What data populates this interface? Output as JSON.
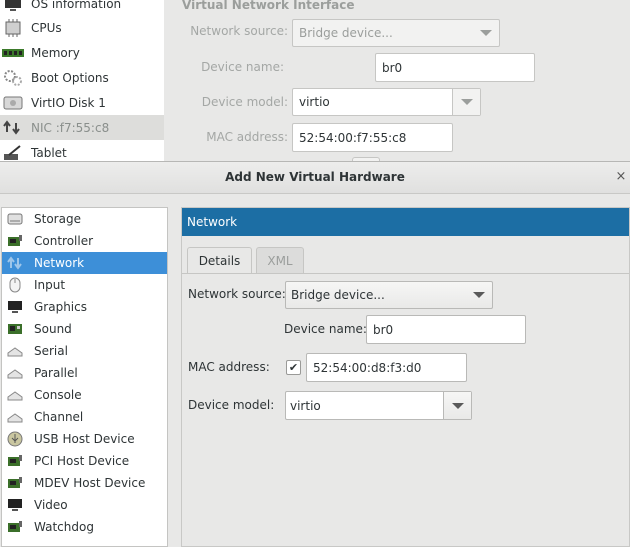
{
  "background_window": {
    "sidebar": [
      {
        "label": "OS information",
        "icon": "monitor-icon"
      },
      {
        "label": "CPUs",
        "icon": "cpu-icon"
      },
      {
        "label": "Memory",
        "icon": "memory-icon"
      },
      {
        "label": "Boot Options",
        "icon": "gears-icon"
      },
      {
        "label": "VirtIO Disk 1",
        "icon": "disk-icon"
      },
      {
        "label": "NIC :f7:55:c8",
        "icon": "nic-icon"
      },
      {
        "label": "Tablet",
        "icon": "tablet-icon"
      }
    ],
    "heading": "Virtual Network Interface",
    "network_source_label": "Network source:",
    "network_source_value": "Bridge device...",
    "device_name_label": "Device name:",
    "device_name_value": "br0",
    "device_model_label": "Device model:",
    "device_model_value": "virtio",
    "mac_label": "MAC address:",
    "mac_value": "52:54:00:f7:55:c8"
  },
  "dialog": {
    "title": "Add New Virtual Hardware",
    "close": "×",
    "hardware_list": [
      {
        "label": "Storage",
        "icon": "storage-icon"
      },
      {
        "label": "Controller",
        "icon": "controller-icon"
      },
      {
        "label": "Network",
        "icon": "network-icon",
        "selected": true
      },
      {
        "label": "Input",
        "icon": "mouse-icon"
      },
      {
        "label": "Graphics",
        "icon": "display-icon"
      },
      {
        "label": "Sound",
        "icon": "sound-card-icon"
      },
      {
        "label": "Serial",
        "icon": "serial-icon"
      },
      {
        "label": "Parallel",
        "icon": "parallel-icon"
      },
      {
        "label": "Console",
        "icon": "console-icon"
      },
      {
        "label": "Channel",
        "icon": "channel-icon"
      },
      {
        "label": "USB Host Device",
        "icon": "usb-icon"
      },
      {
        "label": "PCI Host Device",
        "icon": "pci-icon"
      },
      {
        "label": "MDEV Host Device",
        "icon": "mdev-icon"
      },
      {
        "label": "Video",
        "icon": "video-icon"
      },
      {
        "label": "Watchdog",
        "icon": "watchdog-icon"
      }
    ],
    "pane_header": "Network",
    "tabs": {
      "details": "Details",
      "xml": "XML"
    },
    "network_source_label": "Network source:",
    "network_source_value": "Bridge device...",
    "device_name_label": "Device name:",
    "device_name_value": "br0",
    "mac_label": "MAC address:",
    "mac_checked": true,
    "mac_value": "52:54:00:d8:f3:d0",
    "device_model_label": "Device model:",
    "device_model_value": "virtio"
  },
  "colors": {
    "selection": "#3d8fd8",
    "pane_header": "#1c6ea4",
    "background": "#e8e8e7"
  }
}
